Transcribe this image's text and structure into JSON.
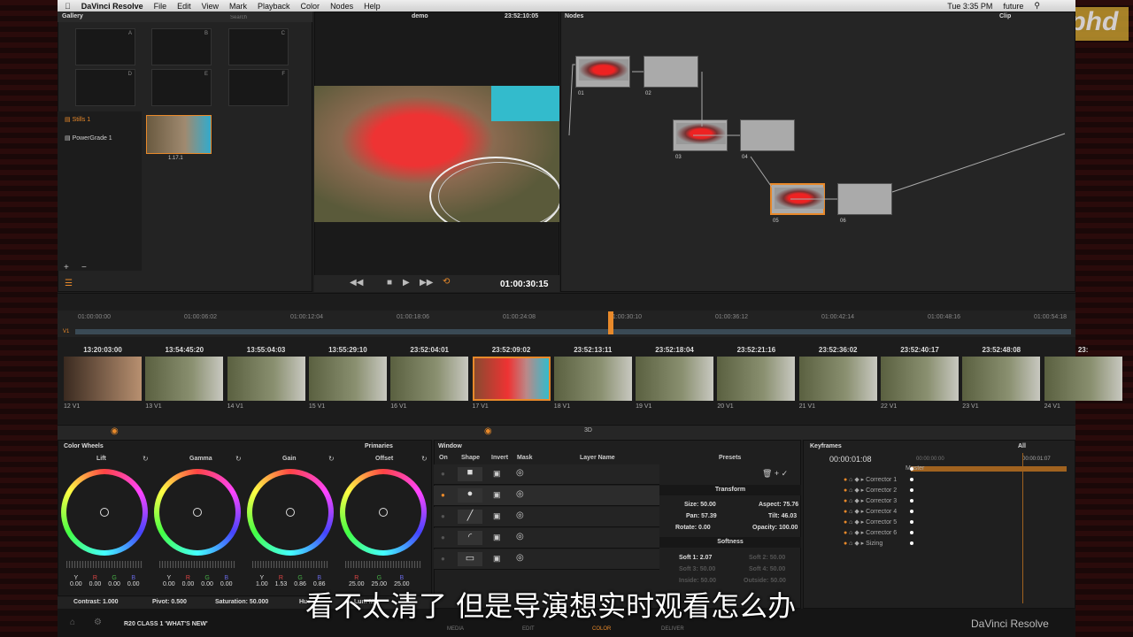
{
  "menu": {
    "app": "DaVinci Resolve",
    "items": [
      "File",
      "Edit",
      "View",
      "Mark",
      "Playback",
      "Color",
      "Nodes",
      "Help"
    ],
    "clock": "Tue 3:35 PM",
    "user": "future"
  },
  "gallery": {
    "title": "Gallery",
    "search_placeholder": "Search",
    "stills_labels": [
      "A",
      "B",
      "C",
      "D",
      "E",
      "F"
    ],
    "albums": [
      "Stills 1",
      "PowerGrade 1"
    ],
    "still_label": "1.17.1"
  },
  "viewer": {
    "project": "demo",
    "timecode_top": "23:52:10:05",
    "timecode": "01:00:30:15"
  },
  "nodes": {
    "title": "Nodes",
    "clip_label": "Clip",
    "labels": [
      "01",
      "02",
      "03",
      "04",
      "05",
      "06"
    ]
  },
  "watermark": "fxphd",
  "timeline": {
    "ruler": [
      "01:00:00:00",
      "01:00:06:02",
      "01:00:12:04",
      "01:00:18:06",
      "01:00:24:08",
      "01:00:30:10",
      "01:00:36:12",
      "01:00:42:14",
      "01:00:48:16",
      "01:00:54:18"
    ],
    "track": "V1",
    "clips": [
      {
        "tc": "13:20:03:00",
        "n": "12",
        "t": "V1"
      },
      {
        "tc": "13:54:45:20",
        "n": "13",
        "t": "V1"
      },
      {
        "tc": "13:55:04:03",
        "n": "14",
        "t": "V1"
      },
      {
        "tc": "13:55:29:10",
        "n": "15",
        "t": "V1"
      },
      {
        "tc": "23:52:04:01",
        "n": "16",
        "t": "V1"
      },
      {
        "tc": "23:52:09:02",
        "n": "17",
        "t": "V1"
      },
      {
        "tc": "23:52:13:11",
        "n": "18",
        "t": "V1"
      },
      {
        "tc": "23:52:18:04",
        "n": "19",
        "t": "V1"
      },
      {
        "tc": "23:52:21:16",
        "n": "20",
        "t": "V1"
      },
      {
        "tc": "23:52:36:02",
        "n": "21",
        "t": "V1"
      },
      {
        "tc": "23:52:40:17",
        "n": "22",
        "t": "V1"
      },
      {
        "tc": "23:52:48:08",
        "n": "23",
        "t": "V1"
      },
      {
        "tc": "23:",
        "n": "24",
        "t": "V1"
      }
    ]
  },
  "wheels": {
    "title": "Color Wheels",
    "mode": "Primaries",
    "items": [
      {
        "name": "Lift",
        "vals": [
          [
            "Y",
            "0.00"
          ],
          [
            "R",
            "0.00"
          ],
          [
            "G",
            "0.00"
          ],
          [
            "B",
            "0.00"
          ]
        ]
      },
      {
        "name": "Gamma",
        "vals": [
          [
            "Y",
            "0.00"
          ],
          [
            "R",
            "0.00"
          ],
          [
            "G",
            "0.00"
          ],
          [
            "B",
            "0.00"
          ]
        ]
      },
      {
        "name": "Gain",
        "vals": [
          [
            "Y",
            "1.00"
          ],
          [
            "R",
            "1.53"
          ],
          [
            "G",
            "0.86"
          ],
          [
            "B",
            "0.86"
          ]
        ]
      },
      {
        "name": "Offset",
        "vals": [
          [
            "R",
            "25.00"
          ],
          [
            "G",
            "25.00"
          ],
          [
            "B",
            "25.00"
          ]
        ]
      }
    ],
    "contrast": "Contrast: 1.000",
    "pivot": "Pivot: 0.500",
    "saturation": "Saturation: 50.000",
    "hue": "Hue",
    "lum": "Lum Mix"
  },
  "window": {
    "title": "Window",
    "cols": [
      "On",
      "Shape",
      "Invert",
      "Mask",
      "Layer Name"
    ],
    "presets": "Presets",
    "transform": "Transform",
    "softness": "Softness",
    "props": {
      "size": "Size: 50.00",
      "aspect": "Aspect: 75.76",
      "pan": "Pan: 57.39",
      "tilt": "Tilt: 46.03",
      "rotate": "Rotate: 0.00",
      "opacity": "Opacity: 100.00",
      "soft1": "Soft 1: 2.07",
      "soft2": "Soft 2: 50.00",
      "soft3": "Soft 3: 50.00",
      "soft4": "Soft 4: 50.00",
      "inside": "Inside: 50.00",
      "outside": "Outside: 50.00"
    }
  },
  "keyframes": {
    "title": "Keyframes",
    "filter": "All",
    "timecode": "00:00:01:08",
    "start": "00:00:00:00",
    "end": "00:00:01:07",
    "tracks": [
      "Master",
      "Corrector 1",
      "Corrector 2",
      "Corrector 3",
      "Corrector 4",
      "Corrector 5",
      "Corrector 6",
      "Sizing"
    ]
  },
  "footer": {
    "project": "R20 CLASS 1 'WHAT'S NEW'",
    "pages": [
      "MEDIA",
      "EDIT",
      "COLOR",
      "DELIVER"
    ],
    "active_page": "COLOR",
    "brand": "DaVinci Resolve"
  },
  "subtitle": "看不太清了 但是导演想实时观看怎么办",
  "colors": {
    "accent": "#e8892a",
    "bg": "#1e1e1e"
  }
}
